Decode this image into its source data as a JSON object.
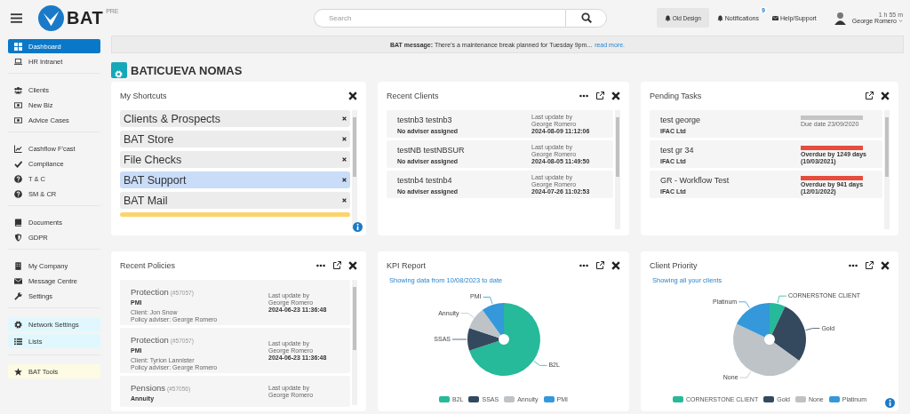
{
  "header": {
    "logo": "BAT",
    "logo_badge": "PRE",
    "search": {
      "placeholder": "Search"
    },
    "old_design": "Old Design",
    "notifications": {
      "label": "Notifications",
      "count": "9"
    },
    "help": "Help/Support",
    "user": {
      "name": "George Romero",
      "session": "1 h 55 m"
    }
  },
  "sidebar": {
    "groups": [
      {
        "items": [
          {
            "label": "Dashboard",
            "selected": true
          },
          {
            "label": "HR Intranet",
            "selected": false
          }
        ]
      },
      {
        "items": [
          {
            "label": "Clients",
            "selected": false
          },
          {
            "label": "New Biz",
            "selected": false
          },
          {
            "label": "Advice Cases",
            "selected": false
          }
        ]
      },
      {
        "items": [
          {
            "label": "Cashflow F'cast",
            "selected": false
          },
          {
            "label": "Compliance",
            "selected": false
          },
          {
            "label": "T & C",
            "selected": false
          },
          {
            "label": "SM & CR",
            "selected": false
          }
        ]
      },
      {
        "items": [
          {
            "label": "Documents",
            "selected": false
          },
          {
            "label": "GDPR",
            "selected": false
          }
        ]
      },
      {
        "items": [
          {
            "label": "My Company",
            "selected": false
          },
          {
            "label": "Message Centre",
            "selected": false
          },
          {
            "label": "Settings",
            "selected": false
          }
        ]
      },
      {
        "color": "#e0f8fd",
        "items": [
          {
            "label": "Network Settings",
            "selected": false
          },
          {
            "label": "Lists",
            "selected": false
          }
        ]
      },
      {
        "color": "#fdfbe3",
        "items": [
          {
            "label": "BAT Tools",
            "selected": false
          }
        ]
      }
    ]
  },
  "message": {
    "text": "**BAT message:** There's a maintenance break planned for Tuesday 9pm...",
    "link": "read more."
  },
  "page_title": "BATICUEVA NOMAS",
  "cards": [
    {
      "kind": "shortcuts",
      "title": "My Shortcuts",
      "menu_button": false,
      "popout_button": false,
      "info_button": true,
      "items": [
        {
          "label": "Clients & Prospects",
          "color": "#ececec"
        },
        {
          "label": "BAT Store",
          "color": "#ececec"
        },
        {
          "label": "File Checks",
          "color": "#ececec"
        },
        {
          "label": "BAT Support",
          "color": "#c9dcf8"
        },
        {
          "label": "BAT Mail",
          "color": "#ececec"
        },
        {
          "color": "#fdd36b"
        }
      ]
    },
    {
      "kind": "clients",
      "title": "Recent Clients",
      "menu_button": true,
      "popout_button": true,
      "info_button": false,
      "items": [
        {
          "name": "testnb3 testnb3",
          "adviser": "No adviser assigned",
          "update_label": "Last update by",
          "updated_by": "George Romero",
          "date": "2024-08-09 11:12:06"
        },
        {
          "name": "testNB testNBSUR",
          "adviser": "No adviser assigned",
          "update_label": "Last update by",
          "updated_by": "George Romero",
          "date": "2024-08-05 11:49:50"
        },
        {
          "name": "testnb4 testnb4",
          "adviser": "No adviser assigned",
          "update_label": "Last update by",
          "updated_by": "George Romero",
          "date": "2024-07-26 11:02:53"
        }
      ]
    },
    {
      "kind": "tasks",
      "title": "Pending Tasks",
      "menu_button": false,
      "popout_button": true,
      "info_button": false,
      "items": [
        {
          "name": "test george",
          "company": "IFAC Ltd",
          "color": "#c4c4c4",
          "overdue": false,
          "status": "Due date 23/09/2020"
        },
        {
          "name": "test gr 34",
          "company": "IFAC Ltd",
          "color": "#e74c3c",
          "overdue": true,
          "status": "Overdue by 1249 days",
          "date": "(10/03/2021)"
        },
        {
          "name": "GR - Workflow Test",
          "company": "IFAC Ltd",
          "color": "#e74c3c",
          "overdue": true,
          "status": "Overdue by 941 days",
          "date": "(12/01/2022)"
        }
      ]
    },
    {
      "kind": "policies",
      "title": "Recent Policies",
      "menu_button": true,
      "popout_button": true,
      "info_button": false,
      "items": [
        {
          "type": "Protection",
          "ref": "(#57057)",
          "product": "PMI",
          "client": "Client: Jon Snow",
          "adviser": "Policy adviser: George Romero",
          "update_label": "Last update by",
          "updated_by": "George Romero",
          "date": "2024-06-23 11:36:48"
        },
        {
          "type": "Protection",
          "ref": "(#57057)",
          "product": "PMI",
          "client": "Client: Tyrion Lannister",
          "adviser": "Policy adviser: George Romero",
          "update_label": "Last update by",
          "updated_by": "George Romero",
          "date": "2024-06-23 11:36:48"
        },
        {
          "type": "Pensions",
          "ref": "(#57056)",
          "product": "Annuity",
          "update_label": "Last update by",
          "updated_by": "George Romero"
        }
      ]
    },
    {
      "kind": "pie",
      "title": "KPI Report",
      "menu_button": true,
      "popout_button": true,
      "info_button": false,
      "subtitle": "Showing data from 10/08/2023 to date",
      "slice_labels": [
        "B2L",
        "SSAS",
        "Annuity",
        "PMI"
      ],
      "legend": [
        {
          "label": "B2L",
          "color": "#26b99a"
        },
        {
          "label": "SSAS",
          "color": "#34495e"
        },
        {
          "label": "Annuity",
          "color": "#bdc3c7"
        },
        {
          "label": "PMI",
          "color": "#3498db"
        }
      ]
    },
    {
      "kind": "pie",
      "title": "Client Priority",
      "menu_button": true,
      "popout_button": true,
      "info_button": true,
      "subtitle": "Showing all your clients",
      "slice_labels": [
        "CORNERSTONE CLIENT",
        "Gold",
        "None",
        "Platinum"
      ],
      "legend": [
        {
          "label": "CORNERSTONE CLIENT",
          "color": "#26b99a"
        },
        {
          "label": "Gold",
          "color": "#34495e"
        },
        {
          "label": "None",
          "color": "#bdc3c7"
        },
        {
          "label": "Platinum",
          "color": "#3498db"
        }
      ]
    }
  ]
}
